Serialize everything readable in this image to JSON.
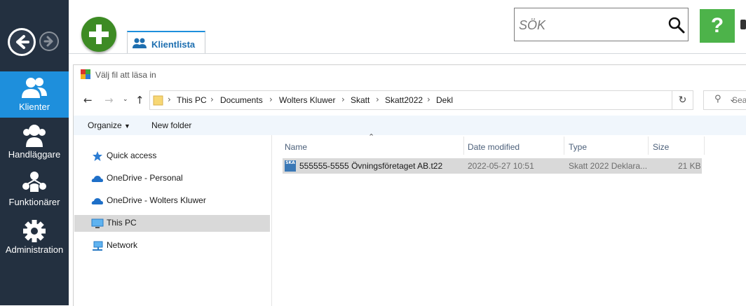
{
  "sidebar": {
    "items": [
      {
        "label": "Klienter",
        "icon": "clients-icon",
        "active": true
      },
      {
        "label": "Handläggare",
        "icon": "handlers-icon",
        "active": false
      },
      {
        "label": "Funktionärer",
        "icon": "officials-icon",
        "active": false
      },
      {
        "label": "Administration",
        "icon": "gear-icon",
        "active": false
      }
    ]
  },
  "topbar": {
    "tab_label": "Klientlista",
    "search_placeholder": "SÖK",
    "help_label": "?"
  },
  "dialog": {
    "title": "Välj fil att läsa in",
    "breadcrumb": [
      "This PC",
      "Documents",
      "Wolters Kluwer",
      "Skatt",
      "Skatt2022",
      "Dekl"
    ],
    "search_placeholder": "Sear",
    "toolbar": {
      "organize": "Organize",
      "new_folder": "New folder"
    },
    "nav_items": [
      {
        "label": "Quick access",
        "icon": "star-icon"
      },
      {
        "label": "OneDrive - Personal",
        "icon": "cloud-icon"
      },
      {
        "label": "OneDrive - Wolters Kluwer",
        "icon": "cloud-icon"
      },
      {
        "label": "This PC",
        "icon": "computer-icon",
        "selected": true
      },
      {
        "label": "Network",
        "icon": "network-icon"
      }
    ],
    "columns": [
      "Name",
      "Date modified",
      "Type",
      "Size"
    ],
    "files": [
      {
        "name": "555555-5555 Övningsföretaget AB.t22",
        "date": "2022-05-27 10:51",
        "type": "Skatt 2022 Deklara...",
        "size": "21 KB",
        "icon_text": "SKA"
      }
    ]
  },
  "colors": {
    "sidebar_bg": "#233040",
    "active_blue": "#1e8fdc",
    "add_green": "#3d8b24",
    "help_green": "#4db34a"
  }
}
